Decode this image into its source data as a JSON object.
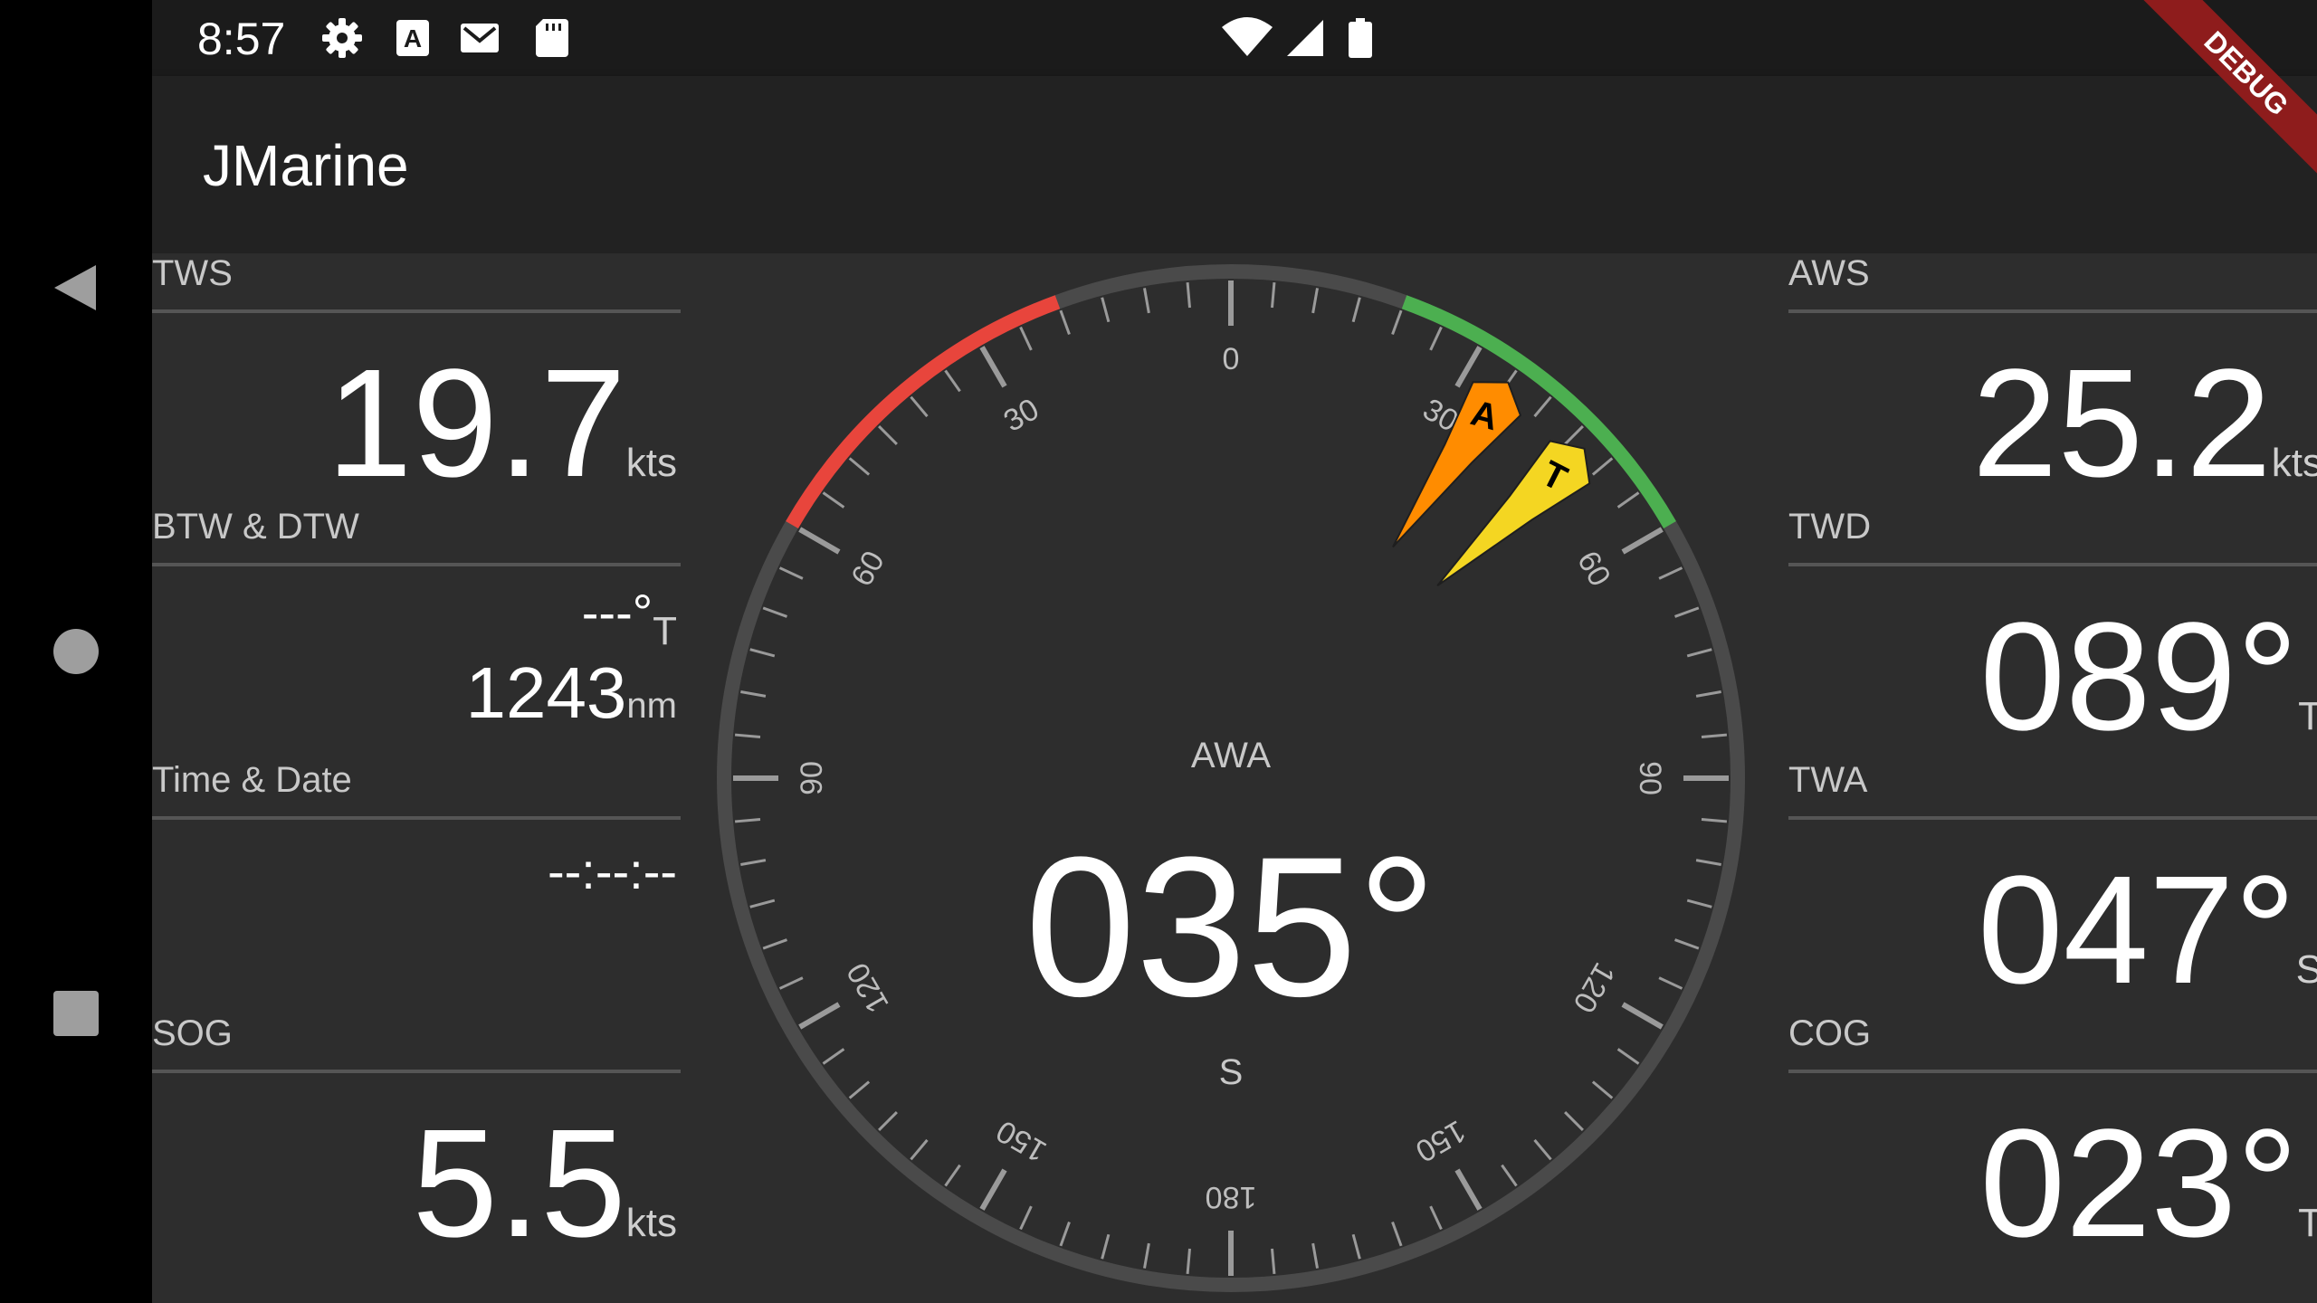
{
  "status_bar": {
    "time": "8:57",
    "icons": [
      "settings-icon",
      "a-box-icon",
      "mail-icon",
      "sd-card-icon",
      "wifi-icon",
      "signal-icon",
      "battery-icon"
    ]
  },
  "app_bar": {
    "title": "JMarine"
  },
  "debug_banner": "DEBUG",
  "nav": [
    "back-icon",
    "home-icon",
    "recents-icon"
  ],
  "left_panels": [
    {
      "label": "TWS",
      "value": "19.7",
      "unit": "kts"
    },
    {
      "label": "BTW & DTW",
      "bearing": "---°",
      "bearing_ref": "T",
      "distance": "1243",
      "distance_unit": "nm"
    },
    {
      "label": "Time & Date",
      "value": "--:--:--"
    },
    {
      "label": "SOG",
      "value": "5.5",
      "unit": "kts"
    }
  ],
  "right_panels": [
    {
      "label": "AWS",
      "value": "25.2",
      "unit": "kts"
    },
    {
      "label": "TWD",
      "value": "089°",
      "unit": "T"
    },
    {
      "label": "TWA",
      "value": "047°",
      "unit": "S"
    },
    {
      "label": "COG",
      "value": "023°",
      "unit": "T"
    }
  ],
  "gauge": {
    "title": "AWA",
    "value": "035°",
    "side": "S",
    "scale_labels": [
      "0",
      "30",
      "60",
      "90",
      "120",
      "150",
      "180",
      "150",
      "120",
      "90",
      "60",
      "30"
    ],
    "colors": {
      "ring": "#4a4a4a",
      "port": "#e8453c",
      "starboard": "#4caf50",
      "apparent": "#ff8c00",
      "true": "#f4d622"
    },
    "pointers": [
      {
        "letter": "A",
        "angle_deg": 35
      },
      {
        "letter": "T",
        "angle_deg": 47
      }
    ]
  }
}
